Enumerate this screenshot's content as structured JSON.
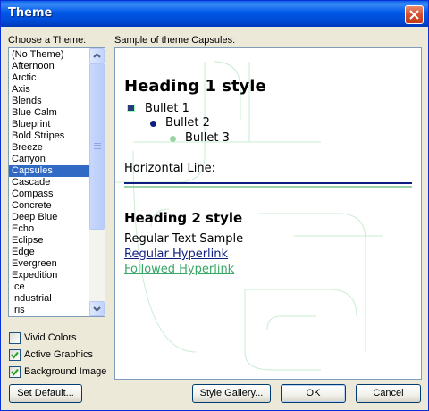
{
  "window": {
    "title": "Theme"
  },
  "labels": {
    "choose_theme": "Choose a Theme:",
    "sample": "Sample of theme Capsules:"
  },
  "themes": [
    "(No Theme)",
    "Afternoon",
    "Arctic",
    "Axis",
    "Blends",
    "Blue Calm",
    "Blueprint",
    "Bold Stripes",
    "Breeze",
    "Canyon",
    "Capsules",
    "Cascade",
    "Compass",
    "Concrete",
    "Deep Blue",
    "Echo",
    "Eclipse",
    "Edge",
    "Evergreen",
    "Expedition",
    "Ice",
    "Industrial",
    "Iris"
  ],
  "selected_theme": "Capsules",
  "options": [
    {
      "label": "Vivid Colors",
      "checked": false
    },
    {
      "label": "Active Graphics",
      "checked": true
    },
    {
      "label": "Background Image",
      "checked": true
    }
  ],
  "sample": {
    "heading1": "Heading 1 style",
    "bullet1": "Bullet 1",
    "bullet2": "Bullet 2",
    "bullet3": "Bullet 3",
    "horizontal_line": "Horizontal Line:",
    "heading2": "Heading 2 style",
    "regular_text": "Regular Text Sample",
    "regular_link": "Regular Hyperlink",
    "followed_link": "Followed Hyperlink"
  },
  "buttons": {
    "set_default": "Set Default...",
    "style_gallery": "Style Gallery...",
    "ok": "OK",
    "cancel": "Cancel"
  },
  "colors": {
    "titlebar": "#0054e3",
    "selection": "#316ac5",
    "link": "#0e1e80",
    "followed_link": "#3aa868"
  }
}
